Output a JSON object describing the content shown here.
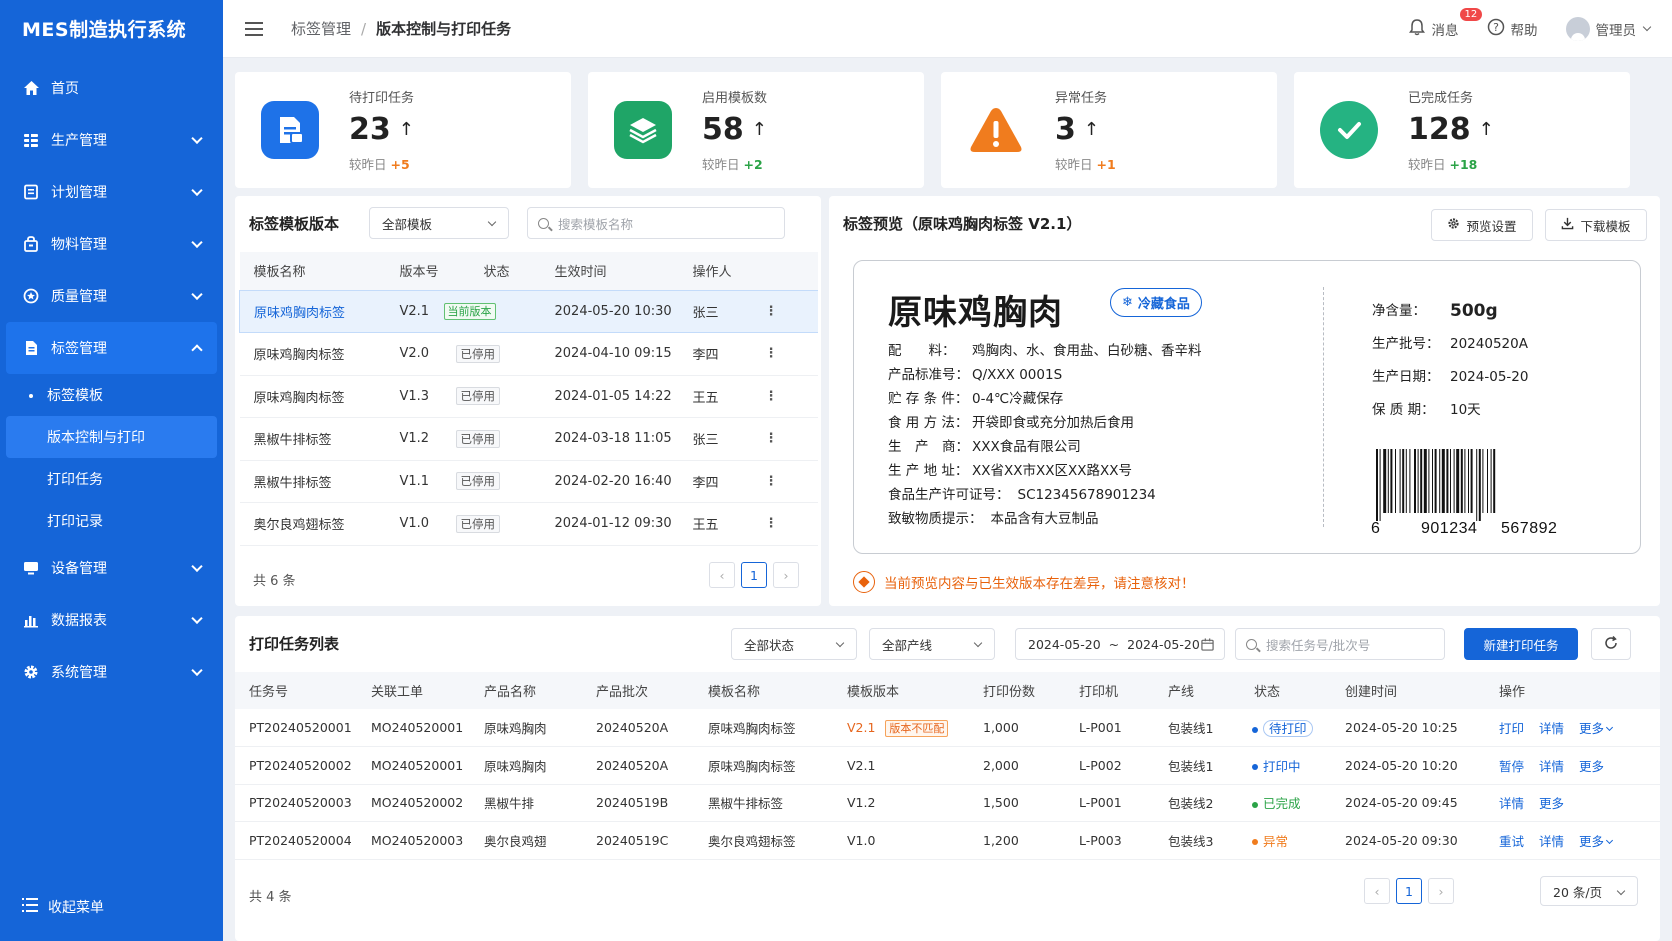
{
  "app": {
    "title": "MES制造执行系统"
  },
  "sidebar": {
    "items": [
      {
        "label": "首页",
        "icon": "home-icon"
      },
      {
        "label": "生产管理",
        "icon": "production-icon"
      },
      {
        "label": "计划管理",
        "icon": "plan-icon"
      },
      {
        "label": "物料管理",
        "icon": "material-icon"
      },
      {
        "label": "质量管理",
        "icon": "quality-icon"
      },
      {
        "label": "标签管理",
        "icon": "label-icon"
      },
      {
        "label": "设备管理",
        "icon": "device-icon"
      },
      {
        "label": "数据报表",
        "icon": "report-icon"
      },
      {
        "label": "系统管理",
        "icon": "settings-icon"
      }
    ],
    "sub": {
      "group": "标签模板",
      "active": "版本控制与打印",
      "task": "打印任务",
      "record": "打印记录"
    },
    "collapse": "收起菜单"
  },
  "header": {
    "breadcrumb": [
      "标签管理",
      "版本控制与打印任务"
    ],
    "separator": "/",
    "messages": "消息",
    "message_count": "12",
    "help": "帮助",
    "user": "管理员"
  },
  "stats": [
    {
      "label": "待打印任务",
      "value": "23",
      "arrow": "↑",
      "compare": "较昨日",
      "delta": "+5",
      "delta_color": "#f07c1e",
      "color": "#1e72e8"
    },
    {
      "label": "启用模板数",
      "value": "58",
      "arrow": "↑",
      "compare": "较昨日",
      "delta": "+2",
      "delta_color": "#2ba347",
      "color": "#1fa567"
    },
    {
      "label": "异常任务",
      "value": "3",
      "arrow": "↑",
      "compare": "较昨日",
      "delta": "+1",
      "delta_color": "#f07c1e",
      "color": "#f07c1e"
    },
    {
      "label": "已完成任务",
      "value": "128",
      "arrow": "↑",
      "compare": "较昨日",
      "delta": "+18",
      "delta_color": "#2ba347",
      "color": "#25b382"
    }
  ],
  "templates": {
    "title": "标签模板版本",
    "filter": "全部模板",
    "search_placeholder": "搜索模板名称",
    "columns": [
      "模板名称",
      "版本号",
      "状态",
      "生效时间",
      "操作人"
    ],
    "rows": [
      {
        "name": "原味鸡胸肉标签",
        "version": "V2.1",
        "status": "当前版本",
        "time": "2024-05-20 10:30",
        "operator": "张三"
      },
      {
        "name": "原味鸡胸肉标签",
        "version": "V2.0",
        "status": "已停用",
        "time": "2024-04-10 09:15",
        "operator": "李四"
      },
      {
        "name": "原味鸡胸肉标签",
        "version": "V1.3",
        "status": "已停用",
        "time": "2024-01-05 14:22",
        "operator": "王五"
      },
      {
        "name": "黑椒牛排标签",
        "version": "V1.2",
        "status": "已停用",
        "time": "2024-03-18 11:05",
        "operator": "张三"
      },
      {
        "name": "黑椒牛排标签",
        "version": "V1.1",
        "status": "已停用",
        "time": "2024-02-20 16:40",
        "operator": "李四"
      },
      {
        "name": "奥尔良鸡翅标签",
        "version": "V1.0",
        "status": "已停用",
        "time": "2024-01-12 09:30",
        "operator": "王五"
      }
    ],
    "total": "共 6 条",
    "page": "1"
  },
  "preview": {
    "title": "标签预览（原味鸡胸肉标签 V2.1）",
    "settings": "预览设置",
    "download": "下载模板",
    "product": "原味鸡胸肉",
    "cold_tag": "冷藏食品",
    "fields": [
      {
        "k": "配　　料：",
        "v": "鸡胸肉、水、食用盐、白砂糖、香辛料"
      },
      {
        "k": "产品标准号：",
        "v": "Q/XXX 0001S"
      },
      {
        "k": "贮 存 条 件：",
        "v": "0-4℃冷藏保存"
      },
      {
        "k": "食 用 方 法：",
        "v": "开袋即食或充分加热后食用"
      },
      {
        "k": "生　产　商：",
        "v": "XXX食品有限公司"
      },
      {
        "k": "生 产 地 址：",
        "v": "XX省XX市XX区XX路XX号"
      },
      {
        "k": "食品生产许可证号：",
        "v": "SC12345678901234"
      },
      {
        "k": "致敏物质提示：",
        "v": "本品含有大豆制品"
      }
    ],
    "right": [
      {
        "k": "净含量：",
        "v": "500g"
      },
      {
        "k": "生产批号：",
        "v": "20240520A"
      },
      {
        "k": "生产日期：",
        "v": "2024-05-20"
      },
      {
        "k": "保 质 期：",
        "v": "10天"
      }
    ],
    "barcode": {
      "d1": "6",
      "d2": "901234",
      "d3": "567892"
    },
    "warning": "当前预览内容与已生效版本存在差异，请注意核对！"
  },
  "jobs": {
    "title": "打印任务列表",
    "status_filter": "全部状态",
    "line_filter": "全部产线",
    "date_from": "2024-05-20",
    "date_sep": "~",
    "date_to": "2024-05-20",
    "search_placeholder": "搜索任务号/批次号",
    "new_button": "新建打印任务",
    "columns": [
      "任务号",
      "关联工单",
      "产品名称",
      "产品批次",
      "模板名称",
      "模板版本",
      "打印份数",
      "打印机",
      "产线",
      "状态",
      "创建时间",
      "操作"
    ],
    "rows": [
      {
        "id": "PT20240520001",
        "order": "MO240520001",
        "product": "原味鸡胸肉",
        "batch": "20240520A",
        "template": "原味鸡胸肉标签",
        "version": "V2.1",
        "mismatch": "版本不匹配",
        "copies": "1,000",
        "printer": "L-P001",
        "line": "包装线1",
        "status": "待打印",
        "status_color": "#1565d8",
        "created": "2024-05-20 10:25",
        "actions": [
          "打印",
          "详情",
          "更多"
        ]
      },
      {
        "id": "PT20240520002",
        "order": "MO240520001",
        "product": "原味鸡胸肉",
        "batch": "20240520A",
        "template": "原味鸡胸肉标签",
        "version": "V2.1",
        "mismatch": "",
        "copies": "2,000",
        "printer": "L-P002",
        "line": "包装线1",
        "status": "打印中",
        "status_color": "#1565d8",
        "created": "2024-05-20 10:20",
        "actions": [
          "暂停",
          "详情",
          "更多"
        ]
      },
      {
        "id": "PT20240520003",
        "order": "MO240520002",
        "product": "黑椒牛排",
        "batch": "20240519B",
        "template": "黑椒牛排标签",
        "version": "V1.2",
        "mismatch": "",
        "copies": "1,500",
        "printer": "L-P001",
        "line": "包装线2",
        "status": "已完成",
        "status_color": "#2ba347",
        "created": "2024-05-20 09:45",
        "actions": [
          "详情",
          "更多"
        ]
      },
      {
        "id": "PT20240520004",
        "order": "MO240520003",
        "product": "奥尔良鸡翅",
        "batch": "20240519C",
        "template": "奥尔良鸡翅标签",
        "version": "V1.0",
        "mismatch": "",
        "copies": "1,200",
        "printer": "L-P003",
        "line": "包装线3",
        "status": "异常",
        "status_color": "#f07c1e",
        "created": "2024-05-20 09:30",
        "actions": [
          "重试",
          "详情",
          "更多"
        ]
      }
    ],
    "total": "共 4 条",
    "page": "1",
    "page_size": "20 条/页"
  }
}
